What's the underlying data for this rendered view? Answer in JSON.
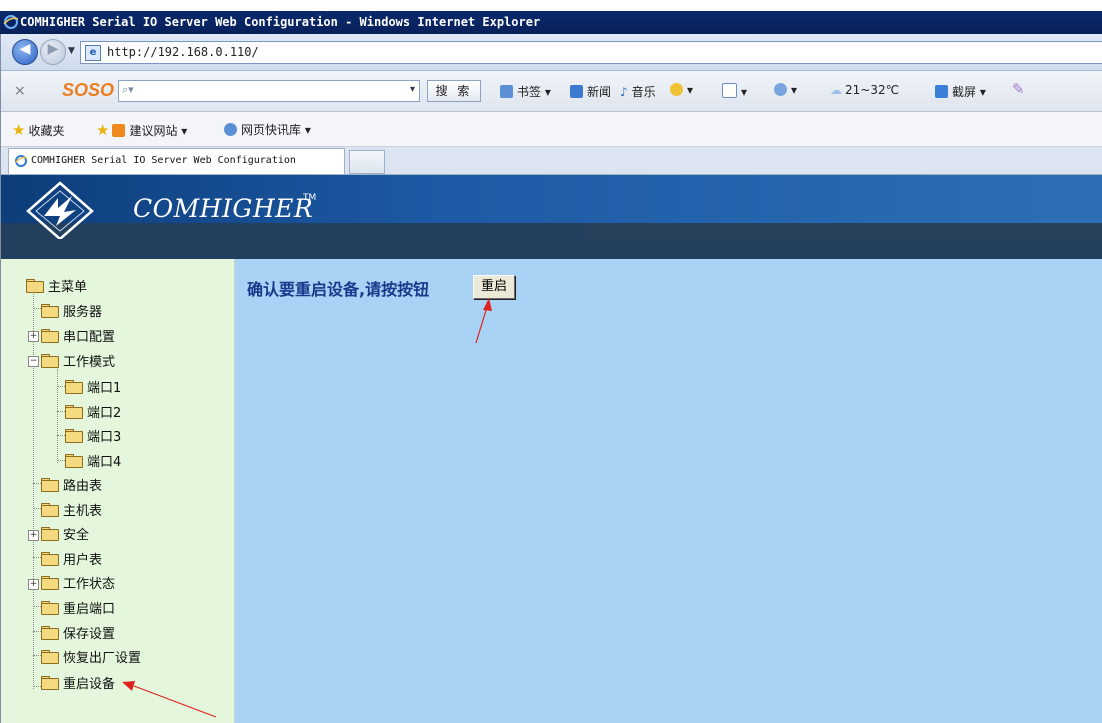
{
  "window": {
    "title": "COMHIGHER Serial IO Server Web Configuration - Windows Internet Explorer"
  },
  "address_bar": {
    "url": "http://192.168.0.110/"
  },
  "search_toolbar": {
    "close": "×",
    "brand": "SOSO",
    "search_button": "搜 索",
    "items": {
      "bookmarks": "书签",
      "news": "新闻",
      "music": "音乐",
      "weather": "21~32℃",
      "screenshot": "截屏"
    }
  },
  "favorites_bar": {
    "favorites": "收藏夹",
    "suggested_sites": "建议网站",
    "web_slice": "网页快讯库"
  },
  "tab": {
    "label": "COMHIGHER Serial IO Server Web Configuration"
  },
  "banner": {
    "brand": "COMHIGHER",
    "tm": "TM"
  },
  "tree": {
    "root": "主菜单",
    "server": "服务器",
    "serial_config": "串口配置",
    "work_mode": "工作模式",
    "port1": "端口1",
    "port2": "端口2",
    "port3": "端口3",
    "port4": "端口4",
    "route_table": "路由表",
    "host_table": "主机表",
    "security": "安全",
    "user_table": "用户表",
    "work_status": "工作状态",
    "restart_port": "重启端口",
    "save_settings": "保存设置",
    "factory_reset": "恢复出厂设置",
    "reboot_device": "重启设备"
  },
  "content": {
    "message": "确认要重启设备,请按按钮",
    "reboot_button": "重启"
  },
  "colors": {
    "sidebar_bg": "#e4f7dc",
    "content_bg": "#a8d3f5",
    "message_text": "#173a8c",
    "annotation_arrow": "#e0221f"
  }
}
